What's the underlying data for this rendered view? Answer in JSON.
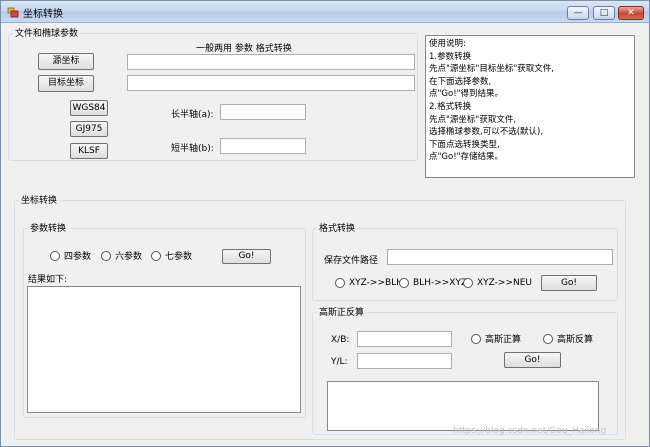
{
  "window": {
    "title": "坐标转换",
    "caption": {
      "minimize": "—",
      "maximize": "□",
      "close": "✕"
    }
  },
  "file_group": {
    "legend": "文件和椭球参数",
    "header_hint": "一般两用 参数 格式转换",
    "source_button": "源坐标",
    "target_button": "目标坐标",
    "source_path": "",
    "target_path": "",
    "ellipsoids": [
      "WGS84",
      "GJ975",
      "KLSF"
    ],
    "semi_major_label": "长半轴(a):",
    "semi_major_value": "",
    "semi_minor_label": "短半轴(b):",
    "semi_minor_value": ""
  },
  "help": {
    "text": "使用说明:\n1.参数转换\n先点\"源坐标\"目标坐标\"获取文件,\n在下面选择参数,\n点\"Go!\"得到结果。\n2.格式转换\n先点\"源坐标\"获取文件,\n选择椭球参数,可以不选(默认),\n下面点选转换类型,\n点\"Go!\"存储结果。"
  },
  "convert_group": {
    "legend": "坐标转换",
    "param": {
      "legend": "参数转换",
      "options": [
        "四参数",
        "六参数",
        "七参数"
      ],
      "go_label": "Go!",
      "result_label": "结果如下:",
      "result_text": ""
    },
    "format": {
      "legend": "格式转换",
      "save_path_label": "保存文件路径",
      "save_path_value": "",
      "options": [
        "XYZ->>BLH",
        "BLH->>XYZ",
        "XYZ->>NEU"
      ],
      "go_label": "Go!"
    },
    "gauss": {
      "legend": "高斯正反算",
      "xb_label": "X/B:",
      "xb_value": "",
      "yl_label": "Y/L:",
      "yl_value": "",
      "options": [
        "高斯正算",
        "高斯反算"
      ],
      "go_label": "Go!",
      "result_text": ""
    }
  },
  "watermark": "https://blog.csdn.net/Gou_Hailong"
}
